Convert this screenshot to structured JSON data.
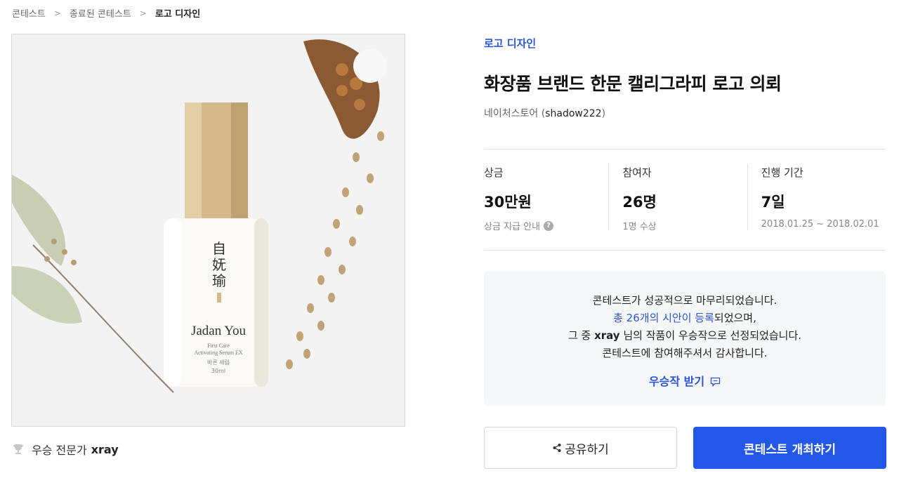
{
  "breadcrumb": {
    "items": [
      "콘테스트",
      "종료된 콘테스트",
      "로고 디자인"
    ]
  },
  "image": {
    "bottle_brand_cn": [
      "自",
      "妩",
      "瑜"
    ],
    "bottle_brand": "Jadan You",
    "bottle_line1": "First Care",
    "bottle_line2": "Activating Serum EX",
    "bottle_line3": "바른 세럼",
    "bottle_line4": "30ml"
  },
  "winner": {
    "label": "우승 전문가",
    "name": "xray"
  },
  "contest": {
    "category": "로고 디자인",
    "title": "화장품 브랜드 한문 캘리그라피 로고 의뢰",
    "owner_name": "네이처스토어",
    "owner_id_open": "(",
    "owner_id": "shadow222",
    "owner_id_close": ")"
  },
  "stats": {
    "prize": {
      "label": "상금",
      "value": "30만원",
      "sub": "상금 지급 안내",
      "help": "?"
    },
    "participants": {
      "label": "참여자",
      "value": "26명",
      "sub": "1명 수상"
    },
    "period": {
      "label": "진행 기간",
      "value": "7일",
      "sub": "2018.01.25 ~ 2018.02.01"
    }
  },
  "notice": {
    "line1": "콘테스트가 성공적으로 마무리되었습니다.",
    "line2_highlight": "총 26개의 시안이 등록",
    "line2_rest": "되었으며,",
    "line3_prefix": "그 중 ",
    "line3_name": "xray",
    "line3_suffix": " 님의 작품이 우승작으로 선정되었습니다.",
    "line4": "콘테스트에 참여해주셔서 감사합니다.",
    "award_link": "우승작 받기"
  },
  "buttons": {
    "share": "공유하기",
    "host": "콘테스트 개최하기"
  },
  "colors": {
    "accent": "#2357e8",
    "link": "#2a56d6",
    "notice_bg": "#f5f6f8"
  }
}
